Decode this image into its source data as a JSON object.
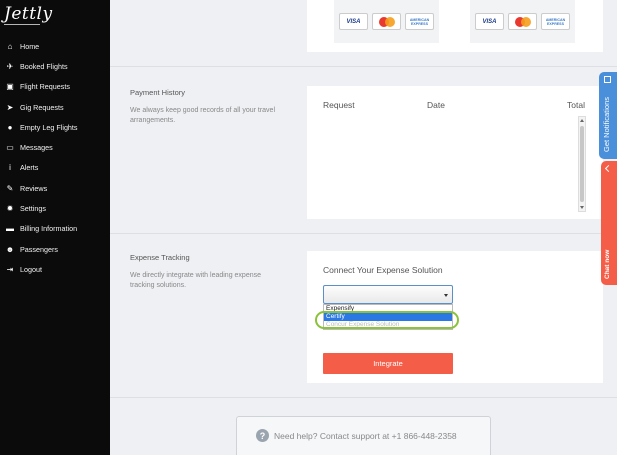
{
  "sidebar": {
    "logo": "Jettly",
    "items": [
      {
        "label": "Home",
        "icon": "home-icon",
        "glyph": "⌂"
      },
      {
        "label": "Booked Flights",
        "icon": "plane-icon",
        "glyph": "✈"
      },
      {
        "label": "Flight Requests",
        "icon": "calendar-check-icon",
        "glyph": "▣"
      },
      {
        "label": "Gig Requests",
        "icon": "jet-icon",
        "glyph": "➤"
      },
      {
        "label": "Empty Leg Flights",
        "icon": "map-marker-icon",
        "glyph": "●"
      },
      {
        "label": "Messages",
        "icon": "inbox-icon",
        "glyph": "▭"
      },
      {
        "label": "Alerts",
        "icon": "info-icon",
        "glyph": "i"
      },
      {
        "label": "Reviews",
        "icon": "edit-icon",
        "glyph": "✎"
      },
      {
        "label": "Settings",
        "icon": "gear-icon",
        "glyph": "✹"
      },
      {
        "label": "Billing Information",
        "icon": "credit-card-icon",
        "glyph": "▬"
      },
      {
        "label": "Passengers",
        "icon": "users-icon",
        "glyph": "☻"
      },
      {
        "label": "Logout",
        "icon": "sign-out-icon",
        "glyph": "⇥"
      }
    ]
  },
  "cards": {
    "visa": "VISA",
    "amex": "AMERICAN EXPRESS"
  },
  "payment_history": {
    "title": "Payment History",
    "description": "We always keep good records of all your travel arrangements.",
    "columns": [
      "Request",
      "Date",
      "Total"
    ]
  },
  "expense": {
    "title": "Expense Tracking",
    "description": "We directly integrate with leading expense tracking solutions.",
    "connect_title": "Connect Your Expense Solution",
    "select_value": "",
    "options": [
      "Expensify",
      "Certify",
      "Concur Expense Solution"
    ],
    "selected_option": "Certify",
    "integrate_label": "Integrate"
  },
  "help": {
    "text": "Need help? Contact support at +1 866-448-2358",
    "icon_glyph": "?"
  },
  "side_tabs": {
    "notifications": "Get Notifications",
    "chat": "Chat now"
  },
  "colors": {
    "sidebar_bg": "#0b0b0b",
    "accent_red": "#f45d48",
    "accent_blue": "#4a8fd9",
    "highlight_green": "#8ac23a"
  }
}
